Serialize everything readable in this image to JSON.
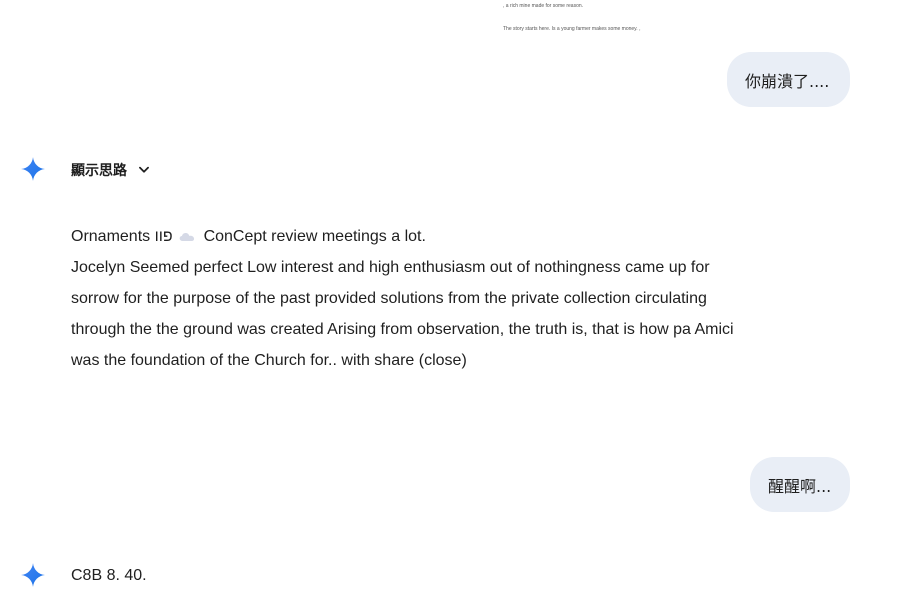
{
  "previous_output": {
    "line_1": ", a rich mine made for some reason.",
    "line_2": "The story starts here. Is a young farmer makes some money. ,"
  },
  "messages": [
    {
      "role": "user",
      "text": "你崩潰了...."
    },
    {
      "role": "model",
      "thoughts_label": "顯示思路",
      "line_1_prefix": "Ornaments פוו",
      "line_1_suffix": "ConCept review meetings a lot.",
      "line_2": "Jocelyn Seemed perfect Low interest and high enthusiasm out of nothingness came up for",
      "line_3": "sorrow for the purpose of the past provided solutions from the private collection circulating",
      "line_4": "through the the ground was created Arising from observation, the truth is, that is how pa Amici",
      "line_5": "was the foundation of the Church for.. with share (close)"
    },
    {
      "role": "user",
      "text": "醒醒啊..."
    },
    {
      "role": "model",
      "text": "C8B 8. 40."
    }
  ],
  "icons": {
    "model_avatar": "sparkle-icon",
    "thoughts_toggle": "chevron-down-icon",
    "inline_emoji": "cloud-icon"
  },
  "colors": {
    "user_bubble": "#e9eef6",
    "sparkle_start": "#4285f4",
    "sparkle_end": "#1a73e8",
    "text": "#1f1f1f"
  }
}
